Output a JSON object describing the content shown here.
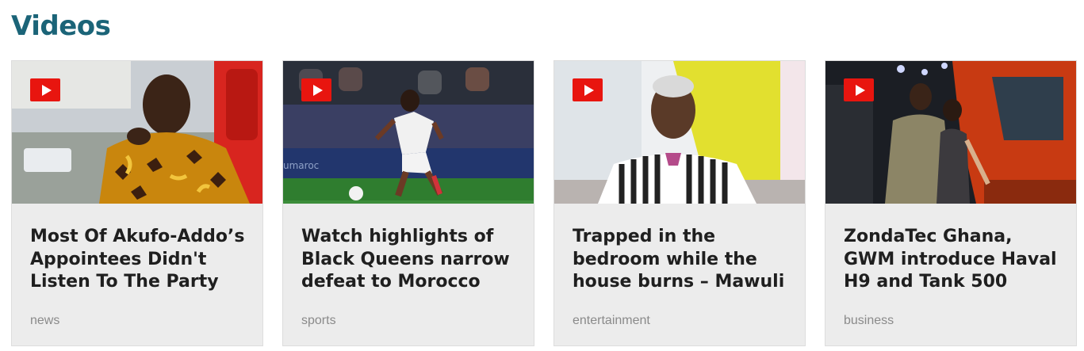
{
  "section": {
    "title": "Videos"
  },
  "cards": [
    {
      "title": "Most Of Akufo-Addo’s Appointees Didn't Listen To The Party",
      "category": "news",
      "icon": "play-icon"
    },
    {
      "title": "Watch highlights of Black Queens narrow defeat to Morocco",
      "category": "sports",
      "icon": "play-icon"
    },
    {
      "title": "Trapped in the bedroom while the house burns – Mawuli",
      "category": "entertainment",
      "icon": "play-icon"
    },
    {
      "title": "ZondaTec Ghana, GWM introduce Haval H9 and Tank 500",
      "category": "business",
      "icon": "play-icon"
    }
  ],
  "colors": {
    "heading": "#1b6478",
    "play_button": "#e8150f",
    "card_background": "#ececec",
    "category_text": "#8a8a8a"
  }
}
